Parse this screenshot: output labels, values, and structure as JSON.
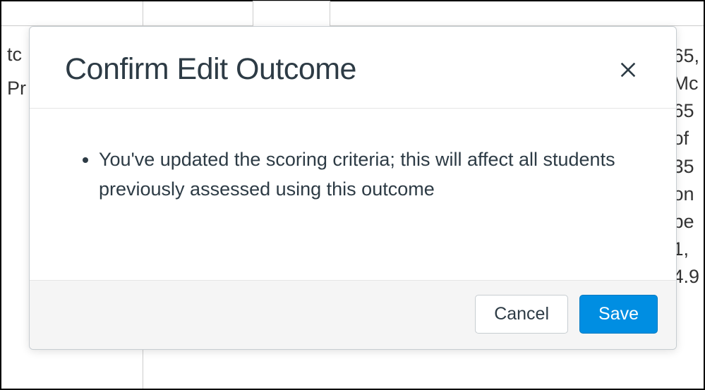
{
  "modal": {
    "title": "Confirm Edit Outcome",
    "message": "You've updated the scoring criteria; this will affect all students previously assessed using this outcome",
    "cancel_label": "Cancel",
    "save_label": "Save"
  },
  "backdrop": {
    "left_text_1": "tc",
    "left_text_2": "Pr",
    "right_lines": [
      "65,",
      "Mc",
      "65",
      "of",
      "35",
      "on",
      "pe",
      "1,",
      "4.9"
    ]
  }
}
